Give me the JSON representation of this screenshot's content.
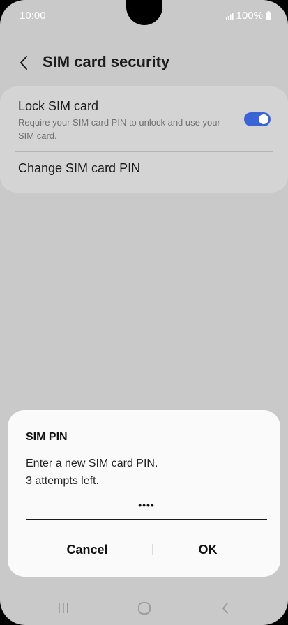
{
  "status_bar": {
    "time": "10:00",
    "battery": "100%",
    "icons": [
      "signal-icon",
      "battery-icon"
    ]
  },
  "header": {
    "back_icon": "chevron-left-icon",
    "title": "SIM card security"
  },
  "settings": {
    "lock_sim": {
      "title": "Lock SIM card",
      "subtitle": "Require your SIM card PIN to unlock and use your SIM card.",
      "enabled": true
    },
    "change_pin": {
      "title": "Change SIM card PIN"
    }
  },
  "dialog": {
    "title": "SIM PIN",
    "message_line1": "Enter a new SIM card PIN.",
    "message_line2": "3 attempts left.",
    "pin_value": "••••",
    "cancel_label": "Cancel",
    "ok_label": "OK"
  },
  "nav_bar": {
    "icons": [
      "recents-icon",
      "home-icon",
      "back-icon"
    ]
  },
  "colors": {
    "background": "#c9c9c9",
    "card": "#d4d4d4",
    "accent": "#3a63d6",
    "dialog": "#fafafa"
  }
}
